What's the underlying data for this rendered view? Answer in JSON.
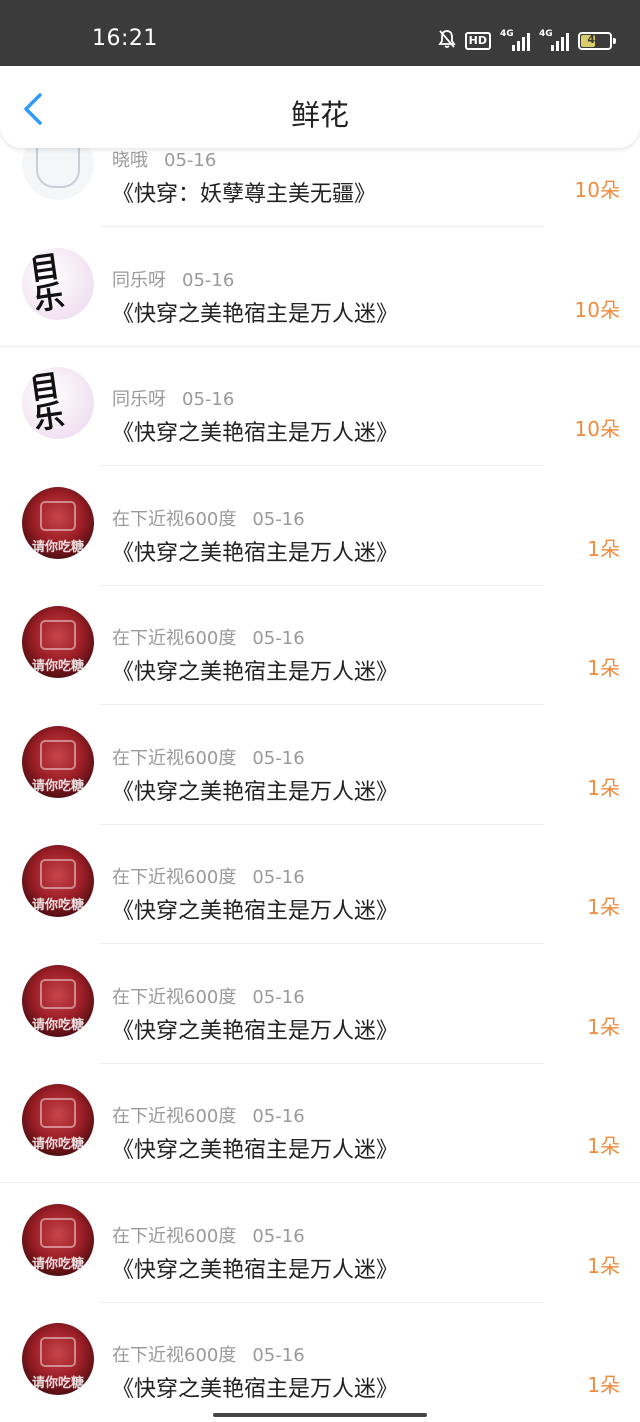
{
  "status_bar": {
    "time": "16:21",
    "hd": "HD",
    "signal1": "4G",
    "signal2": "4G",
    "battery": "49"
  },
  "header": {
    "title": "鲜花"
  },
  "colors": {
    "accent_orange": "#f08a3c",
    "back_blue": "#2f9bff"
  },
  "items": [
    {
      "user": "晓哦",
      "date": "05-16",
      "book": "《快穿：妖孽尊主美无疆》",
      "amount": "10朵",
      "avatar": "sketch"
    },
    {
      "user": "同乐呀",
      "date": "05-16",
      "book": "《快穿之美艳宿主是万人迷》",
      "amount": "10朵",
      "avatar": "pink"
    },
    {
      "user": "同乐呀",
      "date": "05-16",
      "book": "《快穿之美艳宿主是万人迷》",
      "amount": "10朵",
      "avatar": "pink"
    },
    {
      "user": "在下近视600度",
      "date": "05-16",
      "book": "《快穿之美艳宿主是万人迷》",
      "amount": "1朵",
      "avatar": "red"
    },
    {
      "user": "在下近视600度",
      "date": "05-16",
      "book": "《快穿之美艳宿主是万人迷》",
      "amount": "1朵",
      "avatar": "red"
    },
    {
      "user": "在下近视600度",
      "date": "05-16",
      "book": "《快穿之美艳宿主是万人迷》",
      "amount": "1朵",
      "avatar": "red"
    },
    {
      "user": "在下近视600度",
      "date": "05-16",
      "book": "《快穿之美艳宿主是万人迷》",
      "amount": "1朵",
      "avatar": "red"
    },
    {
      "user": "在下近视600度",
      "date": "05-16",
      "book": "《快穿之美艳宿主是万人迷》",
      "amount": "1朵",
      "avatar": "red"
    },
    {
      "user": "在下近视600度",
      "date": "05-16",
      "book": "《快穿之美艳宿主是万人迷》",
      "amount": "1朵",
      "avatar": "red"
    },
    {
      "user": "在下近视600度",
      "date": "05-16",
      "book": "《快穿之美艳宿主是万人迷》",
      "amount": "1朵",
      "avatar": "red"
    },
    {
      "user": "在下近视600度",
      "date": "05-16",
      "book": "《快穿之美艳宿主是万人迷》",
      "amount": "1朵",
      "avatar": "red"
    }
  ],
  "avatar_red_text": "请你吃糖"
}
